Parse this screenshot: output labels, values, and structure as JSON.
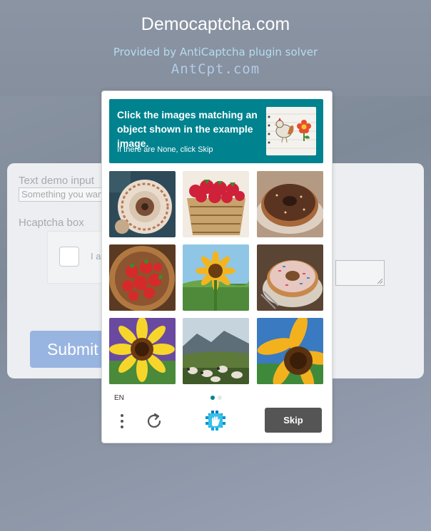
{
  "header": {
    "title": "Democaptcha.com",
    "subtitle": "Provided by AntiCaptcha plugin solver",
    "logo_text": "AntCpt.com"
  },
  "form": {
    "text_label": "Text demo input",
    "text_placeholder": "Something you want",
    "hcaptcha_label": "Hcaptcha box",
    "checkbox_text": "I am human",
    "submit_label": "Submit"
  },
  "captcha": {
    "prompt": "Click the images matching an object shown in the example image.",
    "prompt_sub": "If there are None, click Skip",
    "example_icon": "rooster-and-flower-icon",
    "tiles": [
      {
        "name": "plate-with-donut"
      },
      {
        "name": "basket-of-strawberries"
      },
      {
        "name": "chocolate-donut"
      },
      {
        "name": "strawberries-in-basket"
      },
      {
        "name": "sunflower-field"
      },
      {
        "name": "sprinkle-donut"
      },
      {
        "name": "sunflower-painting"
      },
      {
        "name": "sheep-mountain-landscape"
      },
      {
        "name": "sunflower-closeup"
      }
    ],
    "language": "EN",
    "skip_label": "Skip",
    "page": "1 of 2",
    "accent_color": "#00838f"
  }
}
